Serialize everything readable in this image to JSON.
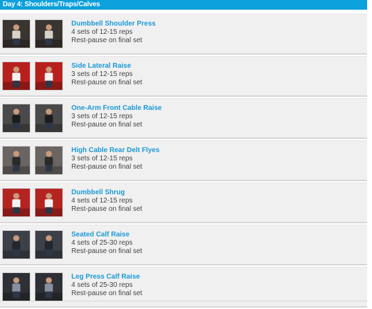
{
  "header": {
    "title": "Day 4: Shoulders/Traps/Calves"
  },
  "exercises": [
    {
      "name": "Dumbbell Shoulder Press",
      "sets": "4 sets of 12-15 reps",
      "note": "Rest-pause on final set",
      "bg": "#3a3530",
      "accent": "#d8d2c8"
    },
    {
      "name": "Side Lateral Raise",
      "sets": "3 sets of 12-15 reps",
      "note": "Rest-pause on final set",
      "bg": "#b8201e",
      "accent": "#f2f2f2"
    },
    {
      "name": "One-Arm Front Cable Raise",
      "sets": "3 sets of 12-15 reps",
      "note": "Rest-pause on final set",
      "bg": "#4a4a4a",
      "accent": "#1c1c1c"
    },
    {
      "name": "High Cable Rear Delt Flyes",
      "sets": "3 sets of 12-15 reps",
      "note": "Rest-pause on final set",
      "bg": "#6a6462",
      "accent": "#2a2a2a"
    },
    {
      "name": "Dumbbell Shrug",
      "sets": "4 sets of 12-15 reps",
      "note": "Rest-pause on final set",
      "bg": "#b42420",
      "accent": "#f2f2f2"
    },
    {
      "name": "Seated Calf Raise",
      "sets": "4 sets of 25-30 reps",
      "note": "Rest-pause on final set",
      "bg": "#3c4048",
      "accent": "#22262e"
    },
    {
      "name": "Leg Press Calf Raise",
      "sets": "4 sets of 25-30 reps",
      "note": "Rest-pause on final set",
      "bg": "#2e3036",
      "accent": "#8890a0"
    }
  ]
}
